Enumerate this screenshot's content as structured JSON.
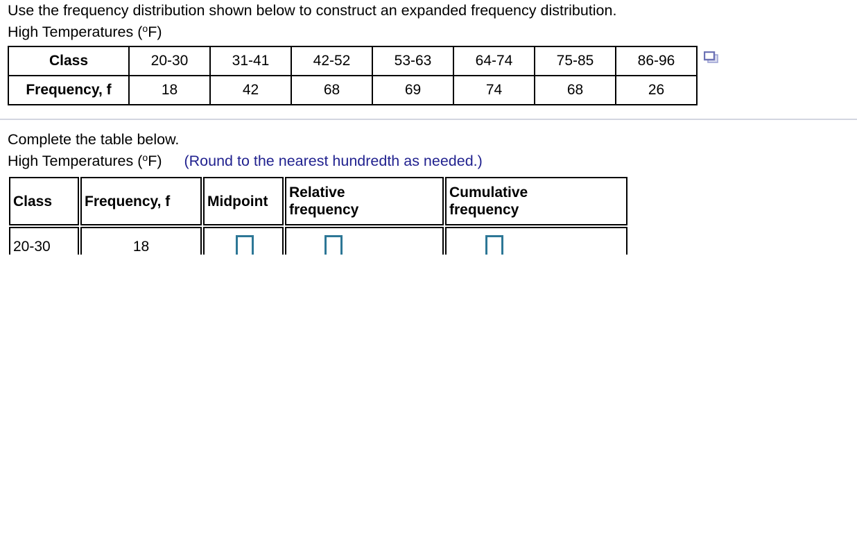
{
  "problem": {
    "instruction": "Use the frequency distribution shown below to construct an expanded frequency distribution.",
    "table_caption_prefix": "High Temperatures (",
    "table_caption_degree": "o",
    "table_caption_suffix": "F)"
  },
  "frequency_table": {
    "row_labels": [
      "Class",
      "Frequency, f"
    ],
    "classes": [
      "20-30",
      "31-41",
      "42-52",
      "53-63",
      "64-74",
      "75-85",
      "86-96"
    ],
    "frequencies": [
      "18",
      "42",
      "68",
      "69",
      "74",
      "68",
      "26"
    ]
  },
  "copy_icon": {
    "name": "copy-icon",
    "color": "#8287c4",
    "fill": "#dcdef0"
  },
  "answer_section": {
    "instruction": "Complete the table below.",
    "caption_prefix": "High Temperatures (",
    "caption_degree": "o",
    "caption_suffix": "F)",
    "rounding_hint": "(Round to the nearest hundredth as needed.)",
    "hint_color": "#21228f"
  },
  "expanded_table": {
    "headers": {
      "class": "Class",
      "frequency": "Frequency, f",
      "midpoint": "Midpoint",
      "relative_line1": "Relative",
      "relative_line2": "frequency",
      "cumulative_line1": "Cumulative",
      "cumulative_line2": "frequency"
    },
    "rows": [
      {
        "class": "20-30",
        "frequency": "18",
        "midpoint": "",
        "relative_frequency": "",
        "cumulative_frequency": ""
      }
    ],
    "input_border_color": "#2d7796"
  }
}
